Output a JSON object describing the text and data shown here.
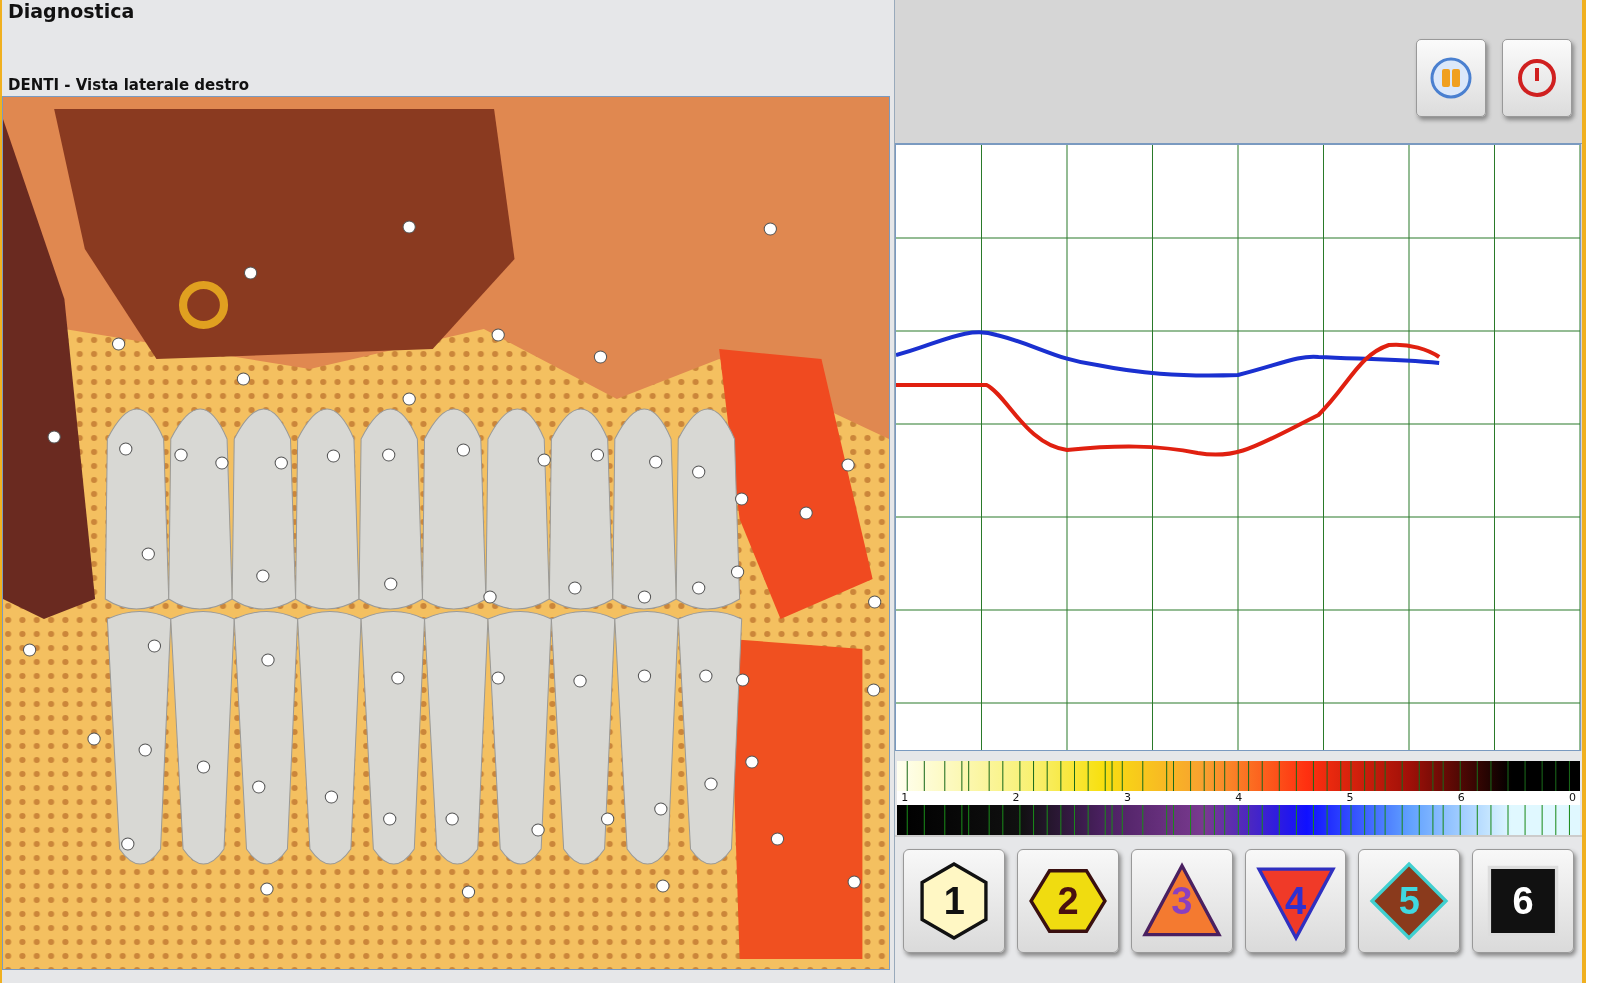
{
  "window": {
    "title": "Diagnostica"
  },
  "view": {
    "title": "DENTI - Vista laterale destro"
  },
  "scale": {
    "labels": [
      "1",
      "2",
      "3",
      "4",
      "5",
      "6",
      "0"
    ]
  },
  "level_buttons": [
    {
      "label": "1",
      "kind": "hexagon",
      "color": "#fff7c4"
    },
    {
      "label": "2",
      "kind": "flathex",
      "color": "#f0dc10"
    },
    {
      "label": "3",
      "kind": "triangle",
      "color": "#f47a30"
    },
    {
      "label": "4",
      "kind": "invtriangle",
      "color": "#f03a28"
    },
    {
      "label": "5",
      "kind": "diamond",
      "color": "#8a3a1c"
    },
    {
      "label": "6",
      "kind": "square",
      "color": "#111111"
    }
  ]
}
